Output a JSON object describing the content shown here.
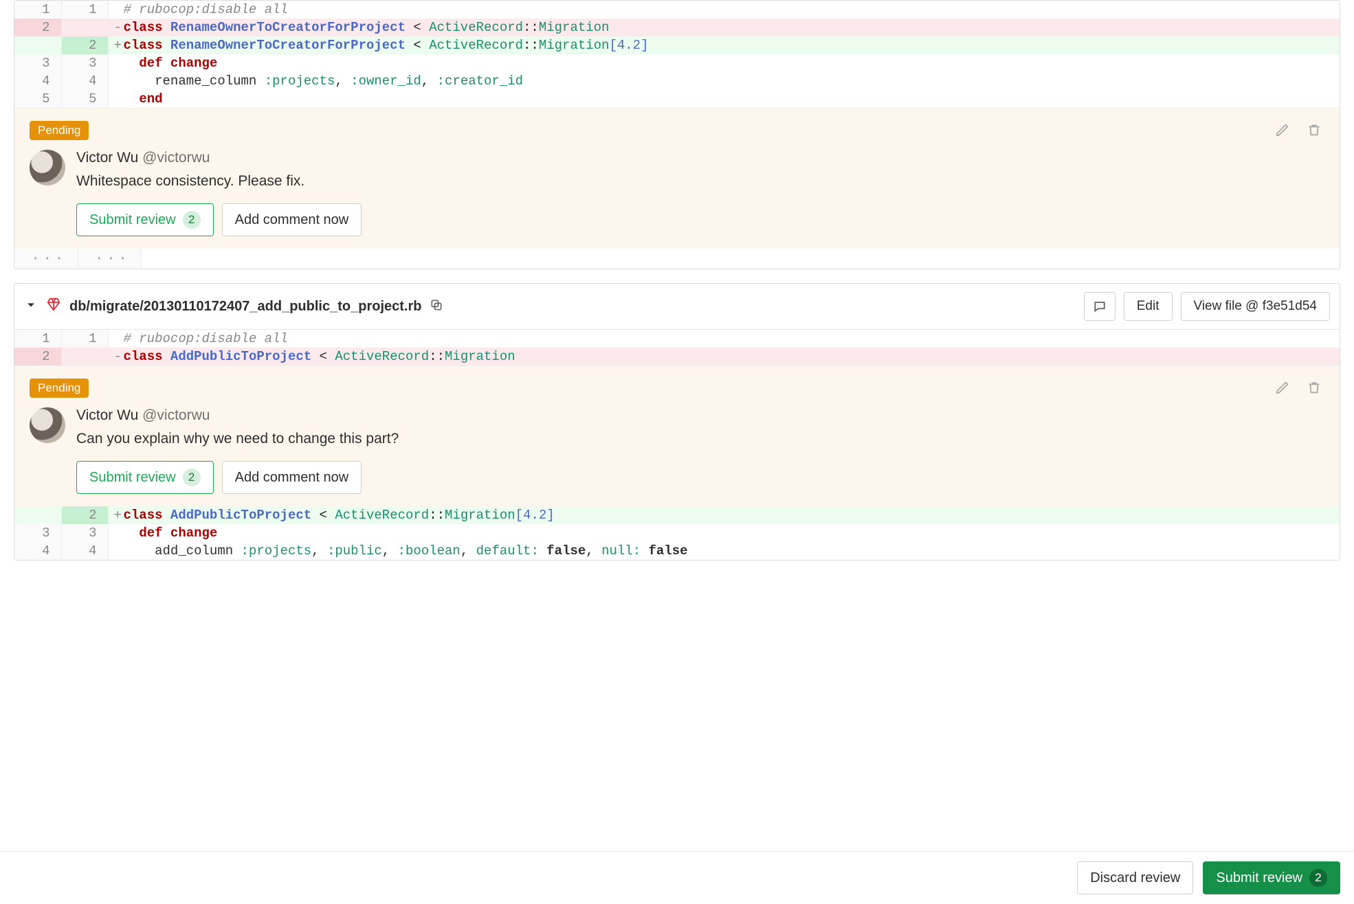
{
  "file1": {
    "rows": [
      {
        "type": "ctx",
        "old": "1",
        "new": "1",
        "sign": "",
        "tokens": [
          {
            "t": "# rubocop:disable all",
            "c": "comment"
          }
        ]
      },
      {
        "type": "del",
        "old": "2",
        "new": "",
        "sign": "-",
        "tokens": [
          {
            "t": "class ",
            "c": "kw"
          },
          {
            "t": "RenameOwnerToCreatorForProject",
            "c": "cls"
          },
          {
            "t": " < ",
            "c": ""
          },
          {
            "t": "ActiveRecord",
            "c": "mod"
          },
          {
            "t": "::",
            "c": ""
          },
          {
            "t": "Migration",
            "c": "mod"
          }
        ]
      },
      {
        "type": "add",
        "old": "",
        "new": "2",
        "sign": "+",
        "tokens": [
          {
            "t": "class ",
            "c": "kw"
          },
          {
            "t": "RenameOwnerToCreatorForProject",
            "c": "cls"
          },
          {
            "t": " < ",
            "c": ""
          },
          {
            "t": "ActiveRecord",
            "c": "mod"
          },
          {
            "t": "::",
            "c": ""
          },
          {
            "t": "Migration",
            "c": "mod"
          },
          {
            "t": "[",
            "c": "brk"
          },
          {
            "t": "4.2",
            "c": "num-lit"
          },
          {
            "t": "]",
            "c": "brk"
          }
        ]
      },
      {
        "type": "ctx",
        "old": "3",
        "new": "3",
        "sign": "",
        "tokens": [
          {
            "t": "  ",
            "c": ""
          },
          {
            "t": "def ",
            "c": "kw"
          },
          {
            "t": "change",
            "c": "kw"
          }
        ]
      },
      {
        "type": "ctx",
        "old": "4",
        "new": "4",
        "sign": "",
        "tokens": [
          {
            "t": "    rename_column ",
            "c": ""
          },
          {
            "t": ":projects",
            "c": "sym"
          },
          {
            "t": ", ",
            "c": ""
          },
          {
            "t": ":owner_id",
            "c": "sym"
          },
          {
            "t": ", ",
            "c": ""
          },
          {
            "t": ":creator_id",
            "c": "sym"
          }
        ]
      },
      {
        "type": "ctx",
        "old": "5",
        "new": "5",
        "sign": "",
        "tokens": [
          {
            "t": "  ",
            "c": ""
          },
          {
            "t": "end",
            "c": "kw"
          }
        ]
      }
    ]
  },
  "comment1": {
    "badge": "Pending",
    "author": "Victor Wu",
    "handle": "@victorwu",
    "body": "Whitespace consistency. Please fix.",
    "submit": "Submit review",
    "count": "2",
    "addnow": "Add comment now"
  },
  "file2": {
    "path": "db/migrate/20130110172407_add_public_to_project.rb",
    "edit": "Edit",
    "viewfile": "View file @ f3e51d54",
    "rowsA": [
      {
        "type": "ctx",
        "old": "1",
        "new": "1",
        "sign": "",
        "tokens": [
          {
            "t": "# rubocop:disable all",
            "c": "comment"
          }
        ]
      },
      {
        "type": "del",
        "old": "2",
        "new": "",
        "sign": "-",
        "tokens": [
          {
            "t": "class ",
            "c": "kw"
          },
          {
            "t": "AddPublicToProject",
            "c": "cls"
          },
          {
            "t": " < ",
            "c": ""
          },
          {
            "t": "ActiveRecord",
            "c": "mod"
          },
          {
            "t": "::",
            "c": ""
          },
          {
            "t": "Migration",
            "c": "mod"
          }
        ]
      }
    ],
    "rowsB": [
      {
        "type": "add",
        "old": "",
        "new": "2",
        "sign": "+",
        "tokens": [
          {
            "t": "class ",
            "c": "kw"
          },
          {
            "t": "AddPublicToProject",
            "c": "cls"
          },
          {
            "t": " < ",
            "c": ""
          },
          {
            "t": "ActiveRecord",
            "c": "mod"
          },
          {
            "t": "::",
            "c": ""
          },
          {
            "t": "Migration",
            "c": "mod"
          },
          {
            "t": "[",
            "c": "brk"
          },
          {
            "t": "4.2",
            "c": "num-lit"
          },
          {
            "t": "]",
            "c": "brk"
          }
        ]
      },
      {
        "type": "ctx",
        "old": "3",
        "new": "3",
        "sign": "",
        "tokens": [
          {
            "t": "  ",
            "c": ""
          },
          {
            "t": "def ",
            "c": "kw"
          },
          {
            "t": "change",
            "c": "kw"
          }
        ]
      },
      {
        "type": "ctx",
        "old": "4",
        "new": "4",
        "sign": "",
        "tokens": [
          {
            "t": "    add_column ",
            "c": ""
          },
          {
            "t": ":projects",
            "c": "sym"
          },
          {
            "t": ", ",
            "c": ""
          },
          {
            "t": ":public",
            "c": "sym"
          },
          {
            "t": ", ",
            "c": ""
          },
          {
            "t": ":boolean",
            "c": "sym"
          },
          {
            "t": ", ",
            "c": ""
          },
          {
            "t": "default: ",
            "c": "sym"
          },
          {
            "t": "false",
            "c": "bool"
          },
          {
            "t": ", ",
            "c": ""
          },
          {
            "t": "null: ",
            "c": "sym"
          },
          {
            "t": "false",
            "c": "bool"
          }
        ]
      }
    ]
  },
  "comment2": {
    "badge": "Pending",
    "author": "Victor Wu",
    "handle": "@victorwu",
    "body": "Can you explain why we need to change this part?",
    "submit": "Submit review",
    "count": "2",
    "addnow": "Add comment now"
  },
  "footer": {
    "discard": "Discard review",
    "submit": "Submit review",
    "count": "2"
  }
}
